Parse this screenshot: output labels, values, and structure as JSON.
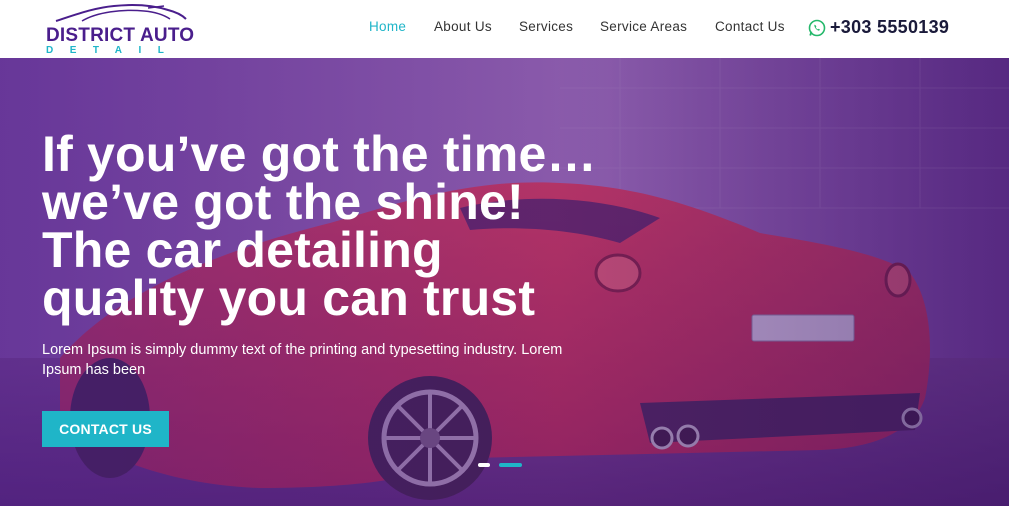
{
  "brand": {
    "name": "DISTRICT AUTO",
    "tagline": "DETAIL"
  },
  "nav": {
    "items": [
      {
        "label": "Home",
        "active": true
      },
      {
        "label": "About Us",
        "active": false
      },
      {
        "label": "Services",
        "active": false
      },
      {
        "label": "Service Areas",
        "active": false
      },
      {
        "label": "Contact Us",
        "active": false
      }
    ],
    "phone": "+303 5550139"
  },
  "hero": {
    "title_lines": [
      "If you’ve got the time…",
      "we’ve got the shine!",
      "The car detailing",
      "quality you can trust"
    ],
    "description": "Lorem Ipsum is simply dummy text of the printing and typesetting industry. Lorem Ipsum has been",
    "cta_label": "CONTACT US",
    "slides": 2,
    "active_slide": 2
  },
  "colors": {
    "accent": "#1fb5c8",
    "brand": "#4a1e8c",
    "overlay": "#5b2a8e",
    "car": "#c8283c"
  },
  "icons": {
    "phone": "whatsapp-icon",
    "logo": "car-silhouette-icon"
  }
}
